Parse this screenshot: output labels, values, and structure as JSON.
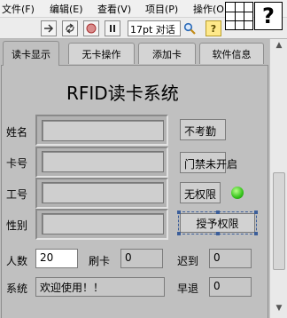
{
  "menubar": {
    "items": [
      "文件(F)",
      "编辑(E)",
      "查看(V)",
      "项目(P)",
      "操作(O"
    ]
  },
  "toolbar": {
    "font_value": "17pt 对话",
    "help_symbol": "?",
    "big_help_symbol": "?"
  },
  "tabs": [
    {
      "label": "读卡显示",
      "active": true
    },
    {
      "label": "无卡操作",
      "active": false
    },
    {
      "label": "添加卡",
      "active": false
    },
    {
      "label": "软件信息",
      "active": false
    }
  ],
  "panel": {
    "title": "RFID读卡系统",
    "fields": [
      {
        "label": "姓名",
        "value": ""
      },
      {
        "label": "卡号",
        "value": ""
      },
      {
        "label": "工号",
        "value": ""
      },
      {
        "label": "性别",
        "value": ""
      }
    ],
    "status": {
      "attendance": "不考勤",
      "door": "门禁未开启",
      "permission": "无权限"
    },
    "grant_button": "授予权限",
    "stats": {
      "people_label": "人数",
      "people_value": "20",
      "swipe_label": "刷卡",
      "swipe_value": "0",
      "late_label": "迟到",
      "late_value": "0",
      "early_label": "早退",
      "early_value": "0"
    },
    "system_label": "系统",
    "system_message": "欢迎使用！！"
  },
  "colors": {
    "panel_bg": "#c0c0c0",
    "led_green": "#34c21a",
    "selection_blue": "#3b5e9a"
  }
}
